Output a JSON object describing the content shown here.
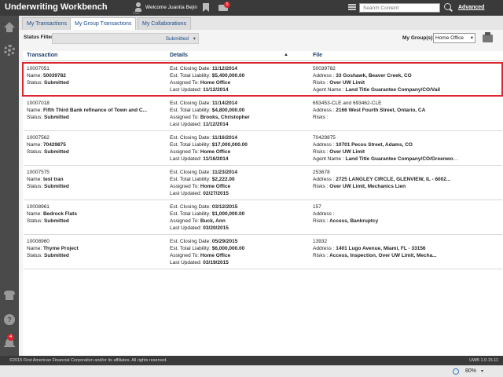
{
  "app": {
    "title": "Underwriting Workbench",
    "welcome": "Welcome Juanita Bejin",
    "user_small_label": "Prod",
    "mail_count": "5",
    "search_placeholder": "Search Content",
    "advanced_label": "Advanced",
    "notification_count": "4",
    "help_glyph": "?"
  },
  "tabs": [
    {
      "label": "My Transactions",
      "active": false
    },
    {
      "label": "My Group Transactions",
      "active": true
    },
    {
      "label": "My Collaborations",
      "active": false
    }
  ],
  "filters": {
    "status_label": "Status Filter:",
    "status_value": "Submitted",
    "groups_label": "My Group(s):",
    "groups_value": "Home Office"
  },
  "table": {
    "headers": [
      "Transaction",
      "Details",
      "File"
    ],
    "rows": [
      {
        "id": "10007051",
        "name": "Name: 50039782",
        "status": "Status: Submitted",
        "closing": "Est. Closing Date: 11/12/2014",
        "liability": "Est. Total Liability: $5,400,000.00",
        "assigned": "Assigned To: Home Office",
        "updated": "Last Updated: 11/12/2014",
        "file": "50039782",
        "address": "Address : 33 Goshawk, Beaver Creek, CO",
        "risks": "Risks : Over UW Limit",
        "agent": "Agent Name : Land Title Guarantee Company/CO/Vail",
        "selected": true
      },
      {
        "id": "10007018",
        "name": "Name: Fifth Third Bank refinance of Town and C...",
        "status": "Status: Submitted",
        "closing": "Est. Closing Date: 11/14/2014",
        "liability": "Est. Total Liability: $4,800,000.00",
        "assigned": "Assigned To: Brooks, Christopher",
        "updated": "Last Updated: 11/12/2014",
        "file": "693453-CLE and 693462-CLE",
        "address": "Address : 2166 West Fourth Street, Ontario, CA",
        "risks": "Risks :",
        "agent": "",
        "selected": false
      },
      {
        "id": "10007562",
        "name": "Name: 70429875",
        "status": "Status: Submitted",
        "closing": "Est. Closing Date: 11/16/2014",
        "liability": "Est. Total Liability: $17,000,000.00",
        "assigned": "Assigned To: Home Office",
        "updated": "Last Updated: 11/16/2014",
        "file": "70429875",
        "address": "Address : 10701 Pecos Street, Adams, CO",
        "risks": "Risks : Over UW Limit",
        "agent": "Agent Name : Land Title Guarantee Company/CO/Greenwoo...",
        "selected": false
      },
      {
        "id": "10007575",
        "name": "Name: test tran",
        "status": "Status: Submitted",
        "closing": "Est. Closing Date: 11/23/2014",
        "liability": "Est. Total Liability: $2,222.00",
        "assigned": "Assigned To: Home Office",
        "updated": "Last Updated: 02/27/2015",
        "file": "253678",
        "address": "Address : 2725 LANGLEY CIRCLE, GLENVIEW, IL - 6002...",
        "risks": "Risks : Over UW Limit, Mechanics Lien",
        "agent": "",
        "selected": false
      },
      {
        "id": "10008961",
        "name": "Name: Bedrock Flats",
        "status": "Status: Submitted",
        "closing": "Est. Closing Date: 03/12/2015",
        "liability": "Est. Total Liability: $1,000,000.00",
        "assigned": "Assigned To: Buck, Ann",
        "updated": "Last Updated: 03/20/2015",
        "file": "157",
        "address": "Address :",
        "risks": "Risks : Access, Bankruptcy",
        "agent": "",
        "selected": false
      },
      {
        "id": "10008960",
        "name": "Name: Thyme Project",
        "status": "Status: Submitted",
        "closing": "Est. Closing Date: 05/29/2015",
        "liability": "Est. Total Liability: $6,000,000.00",
        "assigned": "Assigned To: Home Office",
        "updated": "Last Updated: 03/19/2015",
        "file": "13932",
        "address": "Address : 1401 Lugo Avenue, Miami, FL - 33156",
        "risks": "Risks : Access, Inspection, Over UW Limit, Mecha...",
        "agent": "",
        "selected": false
      }
    ]
  },
  "footer": {
    "copyright": "©2015 First American Financial Corporation and/or its affiliates. All rights reserved.",
    "version": "UWB 1.0.15.11"
  },
  "statusbar": {
    "zoom": "80%"
  },
  "colors": {
    "accent": "#1a4c8c",
    "topbar": "#3a3a3a",
    "selected_border": "#d9262f"
  }
}
